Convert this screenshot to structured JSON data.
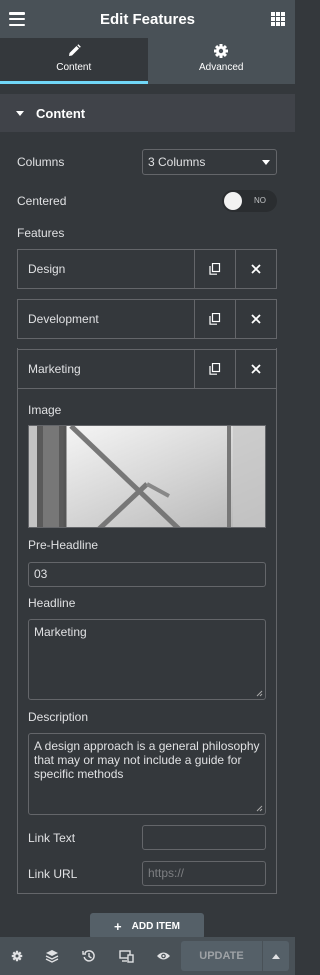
{
  "header": {
    "title": "Edit Features"
  },
  "tabs": [
    {
      "label": "Content",
      "icon": "pencil-icon",
      "active": true
    },
    {
      "label": "Advanced",
      "icon": "gear-icon",
      "active": false
    }
  ],
  "section": {
    "title": "Content"
  },
  "columns": {
    "label": "Columns",
    "value": "3 Columns"
  },
  "centered": {
    "label": "Centered",
    "toggle_text": "NO"
  },
  "features": {
    "label": "Features",
    "items": [
      {
        "title": "Design"
      },
      {
        "title": "Development"
      },
      {
        "title": "Marketing"
      }
    ]
  },
  "open_item": {
    "image_label": "Image",
    "pre_headline_label": "Pre-Headline",
    "pre_headline_value": "03",
    "headline_label": "Headline",
    "headline_value": "Marketing",
    "description_label": "Description",
    "description_value": "A design approach is a general philosophy that may or may not include a guide for specific methods",
    "link_text_label": "Link Text",
    "link_text_value": "",
    "link_url_label": "Link URL",
    "link_url_placeholder": "https://"
  },
  "add_item_label": "ADD ITEM",
  "footer": {
    "update_label": "UPDATE"
  },
  "colors": {
    "accent": "#71d7f7",
    "panel": "#34383c",
    "header": "#495157"
  }
}
